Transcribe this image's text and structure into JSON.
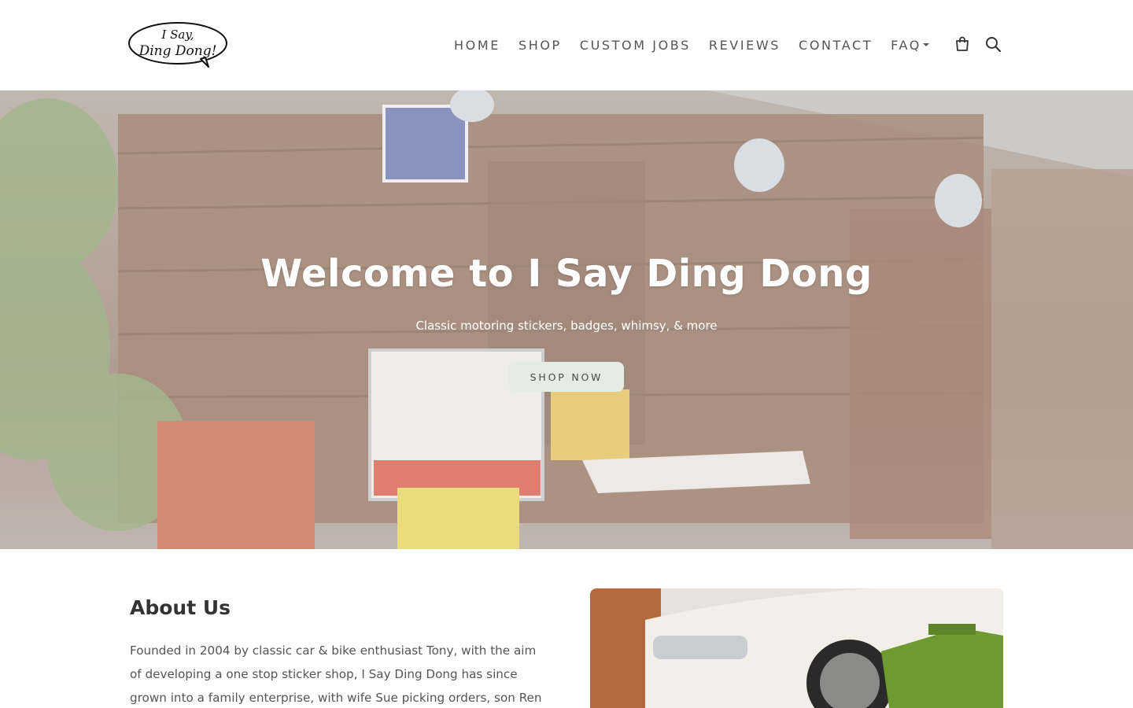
{
  "logo": {
    "line1": "I Say,",
    "line2": "Ding Dong!"
  },
  "nav": {
    "items": [
      "HOME",
      "SHOP",
      "CUSTOM JOBS",
      "REVIEWS",
      "CONTACT"
    ],
    "faq": "FAQ"
  },
  "icons": {
    "cart": "shopping-bag-icon",
    "search": "search-icon",
    "faq_dropdown": "caret-down-icon"
  },
  "hero": {
    "title": "Welcome to I Say Ding Dong",
    "subtitle": "Classic motoring stickers, badges, whimsy, & more",
    "button": "SHOP NOW"
  },
  "about": {
    "title": "About Us",
    "text": "Founded in 2004 by classic car & bike enthusiast Tony, with the aim of developing a one stop sticker shop, I Say Ding Dong has since grown into a family enterprise, with wife Sue picking orders, son Ren"
  },
  "colors": {
    "nav_text": "#555555",
    "button_bg": "#e4ede4",
    "hero_text": "#ffffff"
  }
}
